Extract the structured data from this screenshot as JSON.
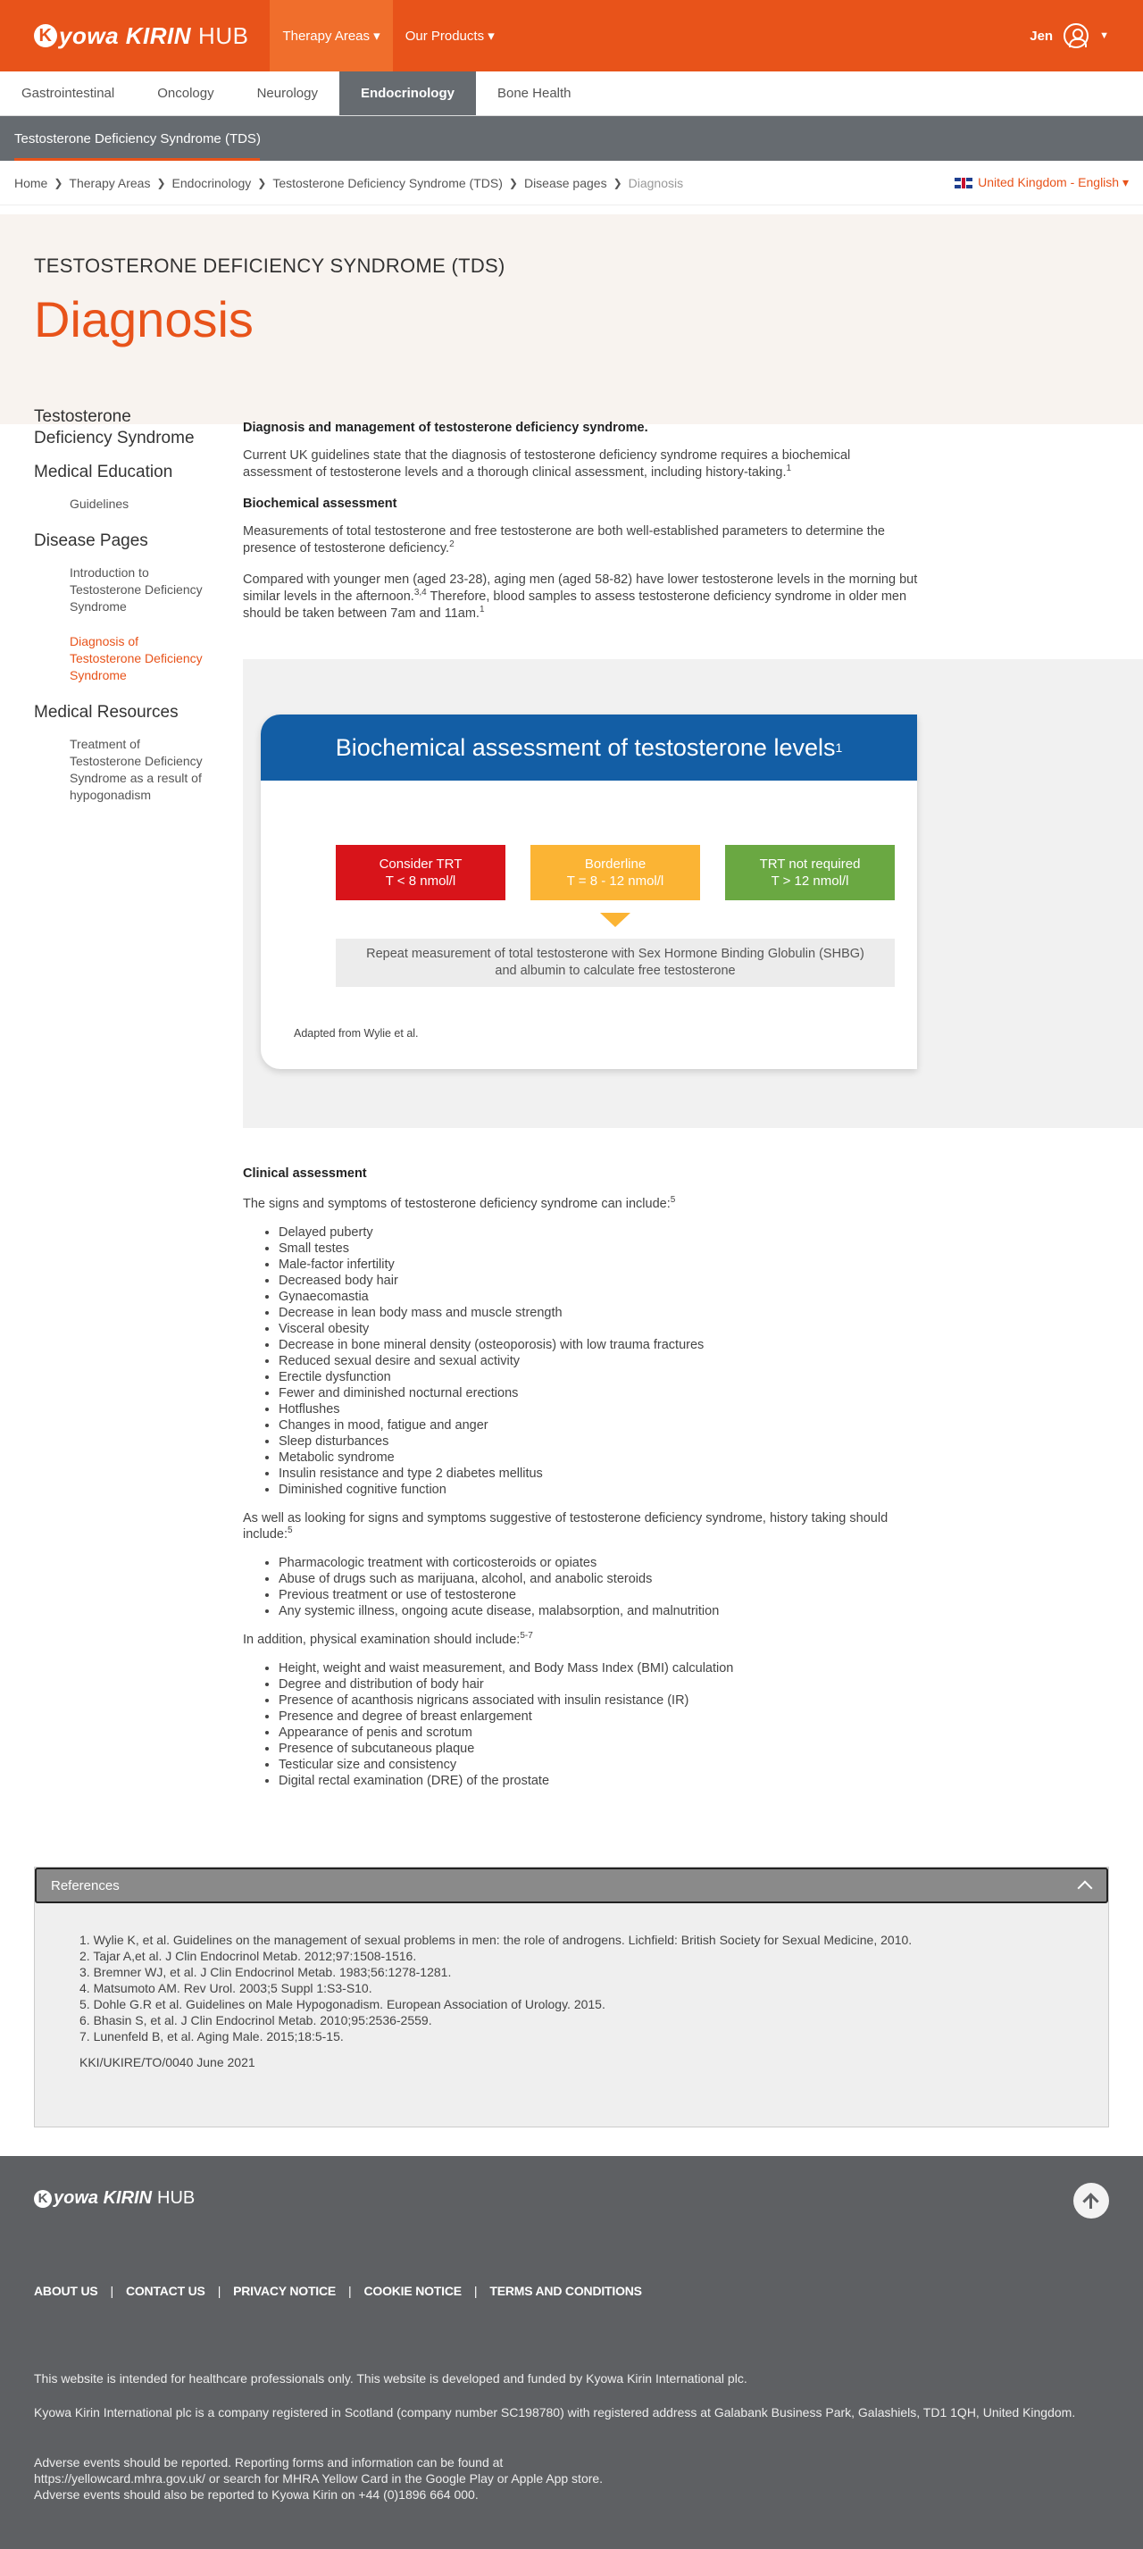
{
  "header": {
    "logo_kyowa": "yowa",
    "logo_kirin": "KIRIN",
    "logo_hub": "HUB",
    "nav": [
      "Therapy Areas ▾",
      "Our Products ▾"
    ],
    "user": "Jen"
  },
  "subnav": [
    "Gastrointestinal",
    "Oncology",
    "Neurology",
    "Endocrinology",
    "Bone Health"
  ],
  "tds_bar": "Testosterone Deficiency Syndrome (TDS)",
  "breadcrumb": [
    "Home",
    "Therapy Areas",
    "Endocrinology",
    "Testosterone Deficiency Syndrome (TDS)",
    "Disease pages",
    "Diagnosis"
  ],
  "language": "United Kingdom - English ▾",
  "hero": {
    "kicker": "TESTOSTERONE DEFICIENCY SYNDROME (TDS)",
    "title": "Diagnosis"
  },
  "sidebar": {
    "h1": "Testosterone Deficiency Syndrome",
    "h2": "Medical Education",
    "s1": "Guidelines",
    "h3": "Disease Pages",
    "s2": "Introduction to Testosterone Deficiency Syndrome",
    "s3": "Diagnosis of Testosterone Deficiency Syndrome",
    "h4": "Medical Resources",
    "s4": "Treatment of Testosterone Deficiency Syndrome as a result of hypogonadism"
  },
  "main": {
    "heading": "Diagnosis and management of testosterone deficiency syndrome.",
    "p1": "Current UK guidelines state that the diagnosis of testosterone deficiency syndrome requires a biochemical assessment of testosterone levels and a thorough clinical assessment, including history-taking.",
    "p1_sup": "1",
    "bio_heading": "Biochemical assessment",
    "p2": "Measurements of total testosterone and free testosterone are both well-established parameters to determine the presence of testosterone deficiency.",
    "p2_sup": "2",
    "p3a": "Compared with younger men (aged 23-28), aging men (aged 58-82) have lower testosterone levels in the morning but similar levels in the afternoon.",
    "p3_sup1": "3,4",
    "p3b": " Therefore, blood samples to assess testosterone deficiency syndrome in older men should be taken between 7am and 11am.",
    "p3_sup2": "1"
  },
  "figure": {
    "title": "Biochemical assessment of testosterone levels",
    "title_sup": "1",
    "red_1": "Consider TRT",
    "red_2": "T < 8 nmol/l",
    "yel_1": "Borderline",
    "yel_2": "T = 8 - 12 nmol/l",
    "grn_1": "TRT not required",
    "grn_2": "T > 12 nmol/l",
    "repeat_1": "Repeat measurement of total testosterone with Sex Hormone Binding Globulin (SHBG)",
    "repeat_2": "and albumin to calculate free testosterone",
    "adapted": "Adapted from Wylie et al.",
    "colors": {
      "red": "#d8141a",
      "yellow": "#fbb434",
      "green": "#6aa842",
      "blue": "#135ea5"
    }
  },
  "clinical": {
    "heading": "Clinical assessment",
    "intro": "The signs and symptoms of testosterone deficiency syndrome can include:",
    "intro_sup": "5",
    "signs": [
      "Delayed puberty",
      "Small testes",
      "Male-factor infertility",
      "Decreased body hair",
      "Gynaecomastia",
      "Decrease in lean body mass and muscle strength",
      "Visceral obesity",
      "Decrease in bone mineral density (osteoporosis) with low trauma fractures",
      "Reduced sexual desire and sexual activity",
      "Erectile dysfunction",
      "Fewer and diminished nocturnal erections",
      "Hotflushes",
      "Changes in mood, fatigue and anger",
      "Sleep disturbances",
      "Metabolic syndrome",
      "Insulin resistance and type 2 diabetes mellitus",
      "Diminished cognitive function"
    ],
    "history_intro": "As well as looking for signs and symptoms suggestive of testosterone deficiency syndrome, history taking should include:",
    "history_sup": "5",
    "history": [
      "Pharmacologic treatment with corticosteroids or opiates",
      "Abuse of drugs such as marijuana, alcohol, and anabolic steroids",
      "Previous treatment or use of testosterone",
      "Any systemic illness, ongoing acute disease, malabsorption, and malnutrition"
    ],
    "exam_intro": "In addition, physical examination should include:",
    "exam_sup": "5-7",
    "exam": [
      "Height, weight and waist measurement, and Body Mass Index (BMI) calculation",
      "Degree and distribution of body hair",
      "Presence of acanthosis nigricans associated with insulin resistance (IR)",
      "Presence and degree of breast enlargement",
      "Appearance of penis and scrotum",
      "Presence of subcutaneous plaque",
      "Testicular size and consistency",
      "Digital rectal examination (DRE) of the prostate"
    ]
  },
  "references": {
    "title": "References",
    "items": [
      "1. Wylie K, et al. Guidelines on the management of sexual problems in men: the role of androgens. Lichfield: British Society for Sexual Medicine, 2010.",
      "2. Tajar A,et al. J Clin Endocrinol Metab. 2012;97:1508-1516.",
      "3. Bremner WJ, et al. J Clin Endocrinol Metab. 1983;56:1278-1281.",
      "4. Matsumoto AM. Rev Urol. 2003;5 Suppl 1:S3-S10.",
      "5. Dohle G.R et al. Guidelines on Male Hypogonadism. European Association of Urology. 2015.",
      "6. Bhasin S, et al. J Clin Endocrinol Metab. 2010;95:2536-2559.",
      "7. Lunenfeld B, et al. Aging Male. 2015;18:5-15."
    ],
    "code": "KKI/UKIRE/TO/0040 June 2021"
  },
  "footer": {
    "links": [
      "ABOUT US",
      "CONTACT US",
      "PRIVACY NOTICE",
      "COOKIE NOTICE",
      "TERMS AND CONDITIONS"
    ],
    "p1": "This website is intended for healthcare professionals only. This website is developed and funded by Kyowa Kirin International plc.",
    "p2": "Kyowa Kirin International plc is a company registered in Scotland (company number SC198780) with registered address at Galabank Business Park, Galashiels, TD1 1QH, United Kingdom.",
    "p3a": "Adverse events should be reported. Reporting forms and information can be found at",
    "p3b": "https://yellowcard.mhra.gov.uk/ or search for MHRA Yellow Card in the Google Play or Apple App store.",
    "p3c": "Adverse events should also be reported to Kyowa Kirin on +44 (0)1896 664 000."
  }
}
